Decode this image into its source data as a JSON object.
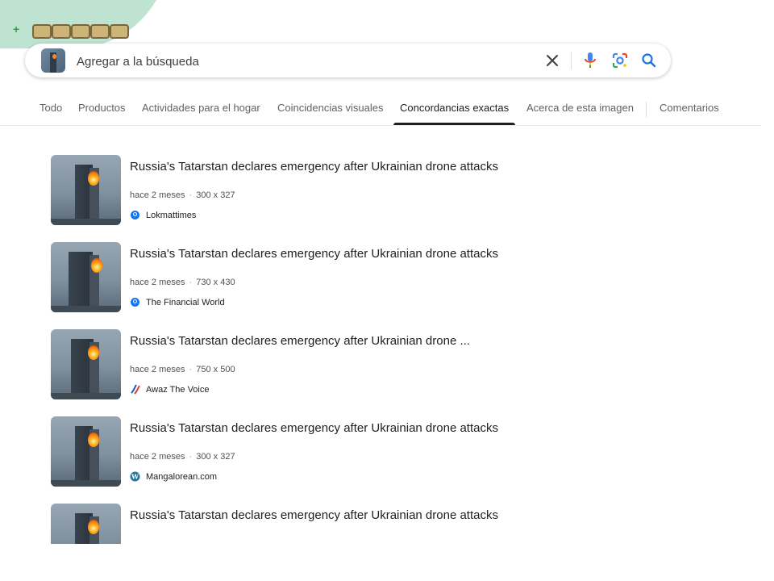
{
  "search": {
    "placeholder": "Agregar a la búsqueda",
    "value": ""
  },
  "icons": {
    "clear": "close-icon",
    "voice": "microphone-icon",
    "lens": "google-lens-icon",
    "search": "search-icon"
  },
  "colors": {
    "active_tab_underline": "#1f1f1f",
    "search_icon_blue": "#1a73e8",
    "mic_red": "#ea4335",
    "mic_blue": "#4285f4",
    "tab_text": "#5f6368"
  },
  "tabs": [
    {
      "label": "Todo",
      "active": false
    },
    {
      "label": "Productos",
      "active": false
    },
    {
      "label": "Actividades para el hogar",
      "active": false
    },
    {
      "label": "Coincidencias visuales",
      "active": false
    },
    {
      "label": "Concordancias exactas",
      "active": true
    },
    {
      "label": "Acerca de esta imagen",
      "active": false
    },
    {
      "label": "Comentarios",
      "active": false
    }
  ],
  "results": [
    {
      "title": "Russia's Tatarstan declares emergency after Ukrainian drone attacks",
      "age": "hace 2 meses",
      "size": "300 x 327",
      "source": "Lokmattimes",
      "source_icon": "globe-icon"
    },
    {
      "title": "Russia's Tatarstan declares emergency after Ukrainian drone attacks",
      "age": "hace 2 meses",
      "size": "730 x 430",
      "source": "The Financial World",
      "source_icon": "globe-icon"
    },
    {
      "title": "Russia's Tatarstan declares emergency after Ukrainian drone ...",
      "age": "hace 2 meses",
      "size": "750 x 500",
      "source": "Awaz The Voice",
      "source_icon": "awaz-logo-icon"
    },
    {
      "title": "Russia's Tatarstan declares emergency after Ukrainian drone attacks",
      "age": "hace 2 meses",
      "size": "300 x 327",
      "source": "Mangalorean.com",
      "source_icon": "wordpress-icon"
    },
    {
      "title": "Russia's Tatarstan declares emergency after Ukrainian drone attacks",
      "age": "",
      "size": "",
      "source": "",
      "source_icon": ""
    }
  ]
}
